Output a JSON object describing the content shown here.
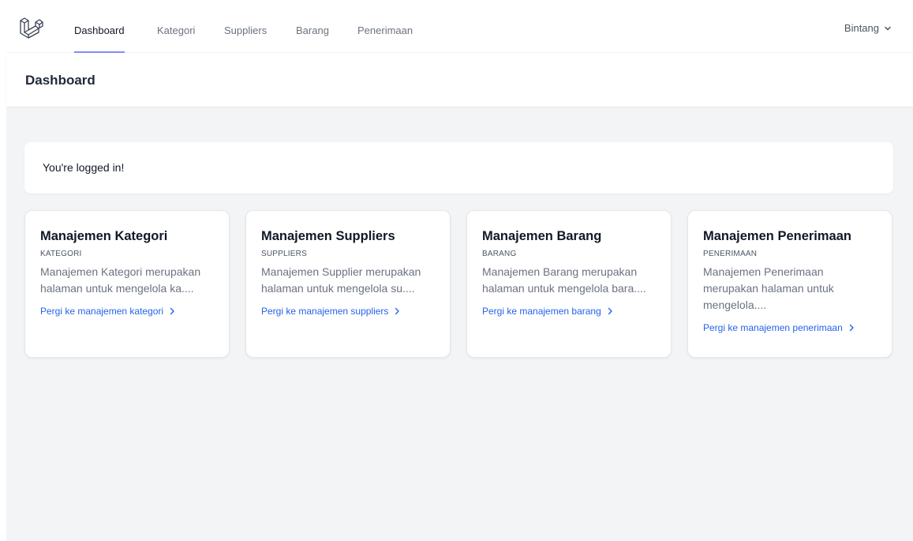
{
  "nav": {
    "items": [
      {
        "label": "Dashboard",
        "active": true
      },
      {
        "label": "Kategori",
        "active": false
      },
      {
        "label": "Suppliers",
        "active": false
      },
      {
        "label": "Barang",
        "active": false
      },
      {
        "label": "Penerimaan",
        "active": false
      }
    ],
    "user": "Bintang"
  },
  "header": {
    "title": "Dashboard"
  },
  "welcome": {
    "message": "You're logged in!"
  },
  "cards": [
    {
      "title": "Manajemen Kategori",
      "subtitle": "KATEGORI",
      "description": "Manajemen Kategori merupakan halaman untuk mengelola ka....",
      "link": "Pergi ke manajemen kategori"
    },
    {
      "title": "Manajemen Suppliers",
      "subtitle": "SUPPLIERS",
      "description": "Manajemen Supplier merupakan halaman untuk mengelola su....",
      "link": "Pergi ke manajemen suppliers"
    },
    {
      "title": "Manajemen Barang",
      "subtitle": "BARANG",
      "description": "Manajemen Barang merupakan halaman untuk mengelola bara....",
      "link": "Pergi ke manajemen barang"
    },
    {
      "title": "Manajemen Penerimaan",
      "subtitle": "PENERIMAAN",
      "description": "Manajemen Penerimaan merupakan halaman untuk mengelola....",
      "link": "Pergi ke manajemen penerimaan"
    }
  ],
  "colors": {
    "accent": "#818cf8",
    "link": "#2563eb",
    "background": "#f3f4f6"
  },
  "icons": {
    "logo": "laravel-logo-icon",
    "user_menu": "chevron-down-icon",
    "card_link": "chevron-right-icon"
  }
}
